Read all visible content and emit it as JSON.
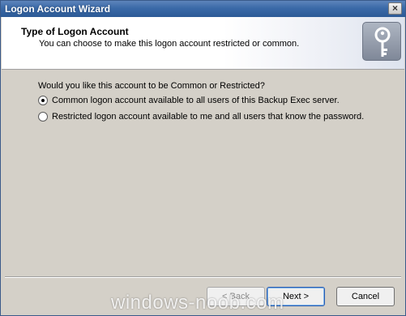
{
  "window": {
    "title": "Logon Account Wizard",
    "close_label": "×"
  },
  "header": {
    "title": "Type of Logon Account",
    "subtitle": "You can choose to make this logon account restricted or common.",
    "icon": "key-icon"
  },
  "content": {
    "question": "Would you like this account to be Common or Restricted?",
    "options": [
      {
        "label": "Common logon account available to all users of this Backup Exec server.",
        "checked": true
      },
      {
        "label": "Restricted logon account available to me and all users that know the password.",
        "checked": false
      }
    ]
  },
  "footer": {
    "back_label": "< Back",
    "next_label": "Next >",
    "cancel_label": "Cancel",
    "watermark": "windows-noob.com"
  }
}
